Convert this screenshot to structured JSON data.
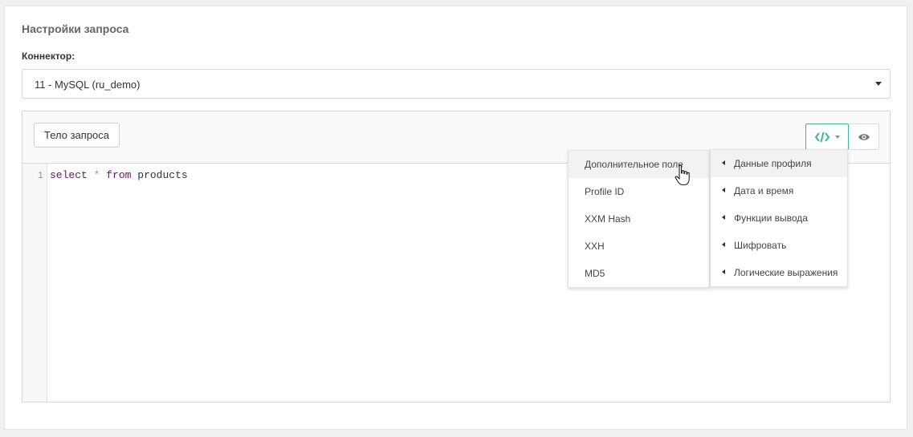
{
  "section": {
    "title": "Настройки запроса",
    "connector_label": "Коннектор:",
    "connector_value": "11 - MySQL (ru_demo)"
  },
  "editor": {
    "body_button": "Тело запроса",
    "line_number": "1",
    "code": {
      "kw_select": "select",
      "star": "*",
      "kw_from": "from",
      "table": "products"
    }
  },
  "menu_left": {
    "items": [
      "Дополнительное поле",
      "Profile ID",
      "XXM Hash",
      "XXH",
      "MD5"
    ]
  },
  "menu_right": {
    "items": [
      "Данные профиля",
      "Дата и время",
      "Функции вывода",
      "Шифровать",
      "Логические выражения"
    ]
  },
  "icons": {
    "code": "code-icon",
    "eye": "eye-icon",
    "caret": "chevron-down-icon",
    "submenu": "chevron-left-icon",
    "cursor": "hand-pointer-icon"
  },
  "colors": {
    "accent": "#3fb68b",
    "keyword": "#7a0874"
  }
}
